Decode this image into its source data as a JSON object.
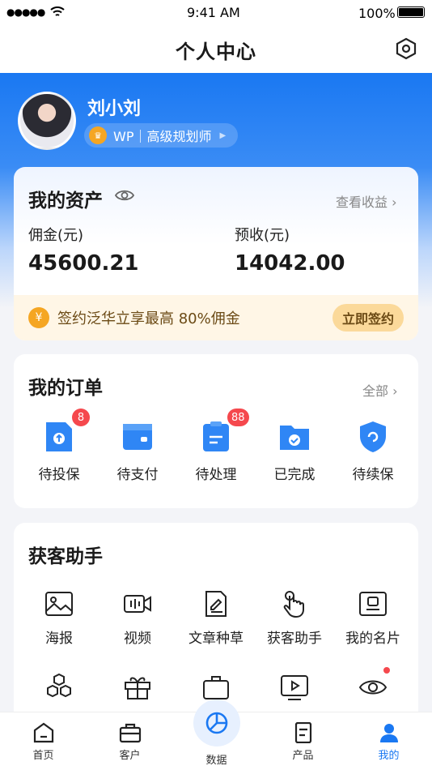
{
  "status": {
    "time": "9:41 AM",
    "battery": "100%"
  },
  "nav": {
    "title": "个人中心"
  },
  "profile": {
    "name": "刘小刘",
    "badge": "WP｜高级规划师"
  },
  "assets": {
    "title": "我的资产",
    "view_income": "查看收益",
    "commission_label": "佣金(元)",
    "commission_value": "45600.21",
    "prereceive_label": "预收(元)",
    "prereceive_value": "14042.00",
    "promo_text": "签约泛华立享最高 80%佣金",
    "promo_button": "立即签约",
    "promo_icon": "¥"
  },
  "orders": {
    "title": "我的订单",
    "all": "全部",
    "items": [
      {
        "label": "待投保",
        "badge": "8"
      },
      {
        "label": "待支付",
        "badge": ""
      },
      {
        "label": "待处理",
        "badge": "88"
      },
      {
        "label": "已完成",
        "badge": ""
      },
      {
        "label": "待续保",
        "badge": ""
      }
    ]
  },
  "tools": {
    "title": "获客助手",
    "items": [
      {
        "label": "海报"
      },
      {
        "label": "视频"
      },
      {
        "label": "文章种草"
      },
      {
        "label": "获客助手"
      },
      {
        "label": "我的名片"
      }
    ]
  },
  "tabbar": {
    "items": [
      {
        "label": "首页"
      },
      {
        "label": "客户"
      },
      {
        "label": "数据"
      },
      {
        "label": "产品"
      },
      {
        "label": "我的"
      }
    ],
    "active_color": "#1a78f2"
  }
}
